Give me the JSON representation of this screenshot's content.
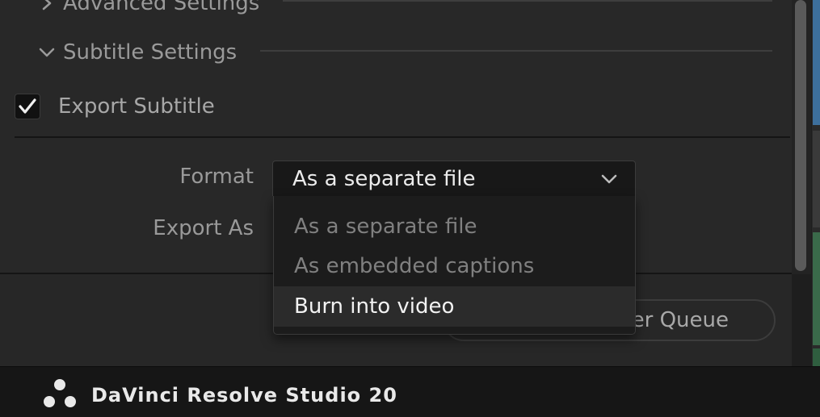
{
  "sections": {
    "advanced_settings_label": "Advanced Settings",
    "subtitle_settings_label": "Subtitle Settings"
  },
  "subtitle": {
    "export_subtitle_label": "Export Subtitle",
    "export_subtitle_checked": true,
    "format_label": "Format",
    "format_value": "As a separate file",
    "export_as_label": "Export As"
  },
  "format_dropdown": {
    "options": [
      {
        "label": "As a separate file",
        "highlighted": false
      },
      {
        "label": "As embedded captions",
        "highlighted": false
      },
      {
        "label": "Burn into video",
        "highlighted": true
      }
    ]
  },
  "actions": {
    "render_queue_button_visible": "er Queue"
  },
  "footer": {
    "brand": "DaVinci Resolve Studio 20",
    "logo_icon": "davinci-resolve-logo-icon"
  },
  "colors": {
    "panel_bg": "#282828",
    "dropdown_bg": "#1c1c1c",
    "highlight_bg": "#2b2b2b",
    "footer_bg": "#161616"
  }
}
